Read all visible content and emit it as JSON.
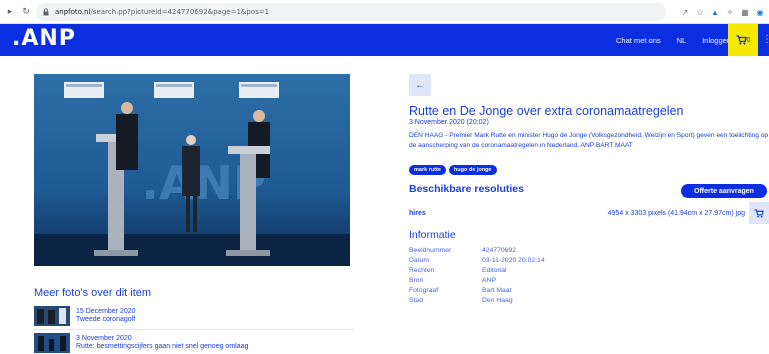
{
  "browser": {
    "url_host": "anpfoto.nl",
    "url_path": "/search.pp?pictureid=424770692&page=1&pos=1"
  },
  "header": {
    "logo": ".ANP",
    "nav": [
      "Chat met ons",
      "NL",
      "Inloggen"
    ],
    "cart_count": "0"
  },
  "photo": {
    "alt": "Rutte en De Jonge persconferentie"
  },
  "related": {
    "title": "Meer foto's over dit item",
    "items": [
      {
        "date": "15 December 2020",
        "caption": "Tweede coronagolf"
      },
      {
        "date": "3 November 2020",
        "caption": "Rutte: besmettingscijfers gaan niet snel genoeg omlaag"
      }
    ]
  },
  "detail": {
    "back_label": "←",
    "title": "Rutte en De Jonge over extra coronamaatregelen",
    "date": "3 November 2020 (20:02)",
    "description": "DEN HAAG - Premier Mark Rutte en minister Hugo de Jonge (Volksgezondheid, Welzijn en Sport) geven een toelichting op de aanscherping van de coronamaatregelen in Nederland. ANP BART MAAT",
    "tags": [
      "mark rutte",
      "hugo de jonge"
    ],
    "resolutions_title": "Beschikbare resoluties",
    "offerte_label": "Offerte aanvragen",
    "resolution": {
      "name": "hires",
      "size": "4954 x 3303 pixels (41.94cm x 27.97cm)  jpg"
    },
    "info_title": "Informatie",
    "info": [
      {
        "key": "Beeldnummer",
        "value": "424770692"
      },
      {
        "key": "Datum",
        "value": "03-11-2020 20:02:14"
      },
      {
        "key": "Rechten",
        "value": "Editorial"
      },
      {
        "key": "Bron",
        "value": "ANP"
      },
      {
        "key": "Fotograaf",
        "value": "Bart Maat"
      },
      {
        "key": "Stad",
        "value": "Den Haag"
      }
    ]
  },
  "colors": {
    "brand_blue": "#0a2ee0",
    "cart_yellow": "#f4e900",
    "text_blue": "#1a3fd8"
  }
}
